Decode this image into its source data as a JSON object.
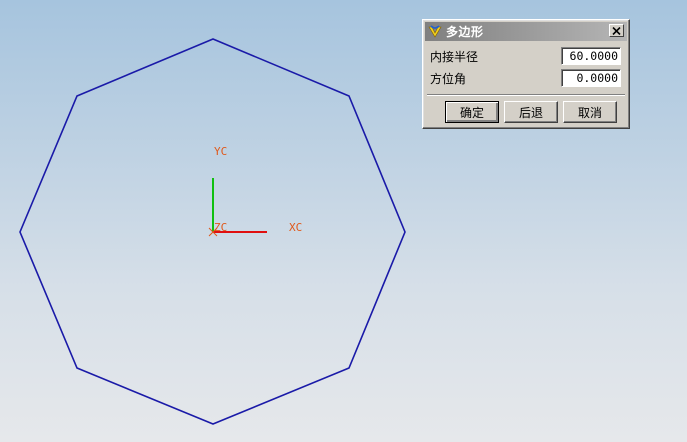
{
  "dialog": {
    "title": "多边形",
    "fields": [
      {
        "label": "内接半径",
        "value": "60.0000"
      },
      {
        "label": "方位角",
        "value": "0.0000"
      }
    ],
    "buttons": {
      "ok": "确定",
      "back": "后退",
      "cancel": "取消"
    }
  },
  "viewport": {
    "axes": {
      "y": "YC",
      "x": "XC",
      "z": "ZC"
    },
    "polygon": {
      "sides": 8,
      "inscribed_radius": 60.0,
      "orientation_angle": 0.0,
      "color": "#1a1aa8"
    },
    "colors": {
      "x_axis": "#e01010",
      "y_axis": "#10c010",
      "labels": "#e0581a"
    }
  }
}
